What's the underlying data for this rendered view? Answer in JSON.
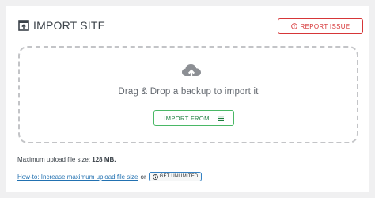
{
  "header": {
    "title": "IMPORT SITE",
    "title_icon": "import-icon",
    "report_button": {
      "label": "REPORT ISSUE",
      "icon": "alert-circle-icon",
      "color": "#d63638"
    }
  },
  "dropzone": {
    "icon": "cloud-upload-icon",
    "text": "Drag & Drop a backup to import it",
    "import_button": {
      "label": "IMPORT FROM",
      "icon": "menu-icon",
      "color": "#1e7e3e"
    }
  },
  "upload_info": {
    "label": "Maximum upload file size:",
    "value": "128 MB."
  },
  "help": {
    "link_text": "How-to: Increase maximum upload file size",
    "or_text": "or",
    "unlimited_button": {
      "label": "GET UNLIMITED",
      "icon": "info-circle-icon"
    }
  }
}
